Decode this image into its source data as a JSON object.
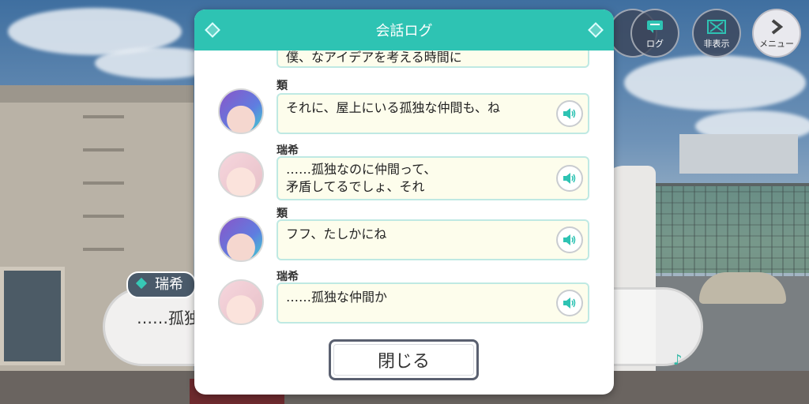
{
  "top_buttons": {
    "log_label": "ログ",
    "hide_label": "非表示",
    "menu_label": "メニュー"
  },
  "background_dialog": {
    "speaker": "瑞希",
    "text": "……孤独"
  },
  "modal": {
    "title": "会話ログ",
    "partial_line": "僕、なアイデアを考える時間に",
    "entries": [
      {
        "speaker": "類",
        "lines": [
          "それに、屋上にいる孤独な仲間も、ね"
        ],
        "avatar": "rui"
      },
      {
        "speaker": "瑞希",
        "lines": [
          "……孤独なのに仲間って、",
          "矛盾してるでしょ、それ"
        ],
        "avatar": "mizuki"
      },
      {
        "speaker": "類",
        "lines": [
          "フフ、たしかにね"
        ],
        "avatar": "rui"
      },
      {
        "speaker": "瑞希",
        "lines": [
          "……孤独な仲間か"
        ],
        "avatar": "mizuki"
      }
    ],
    "close_label": "閉じる"
  },
  "colors": {
    "accent": "#2ec3b3",
    "bubble_bg": "#fdfdec"
  },
  "icons": [
    "log-icon",
    "hide-icon",
    "menu-chevron-icon",
    "speaker-icon",
    "music-note-icon",
    "diamond-icon"
  ]
}
